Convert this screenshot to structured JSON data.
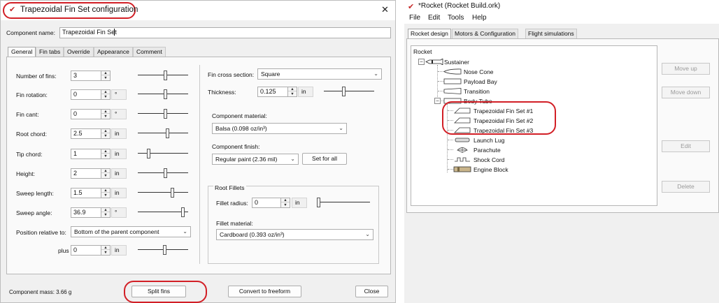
{
  "dialog": {
    "title": "Trapezoidal Fin Set configuration",
    "close_glyph": "✕",
    "component_name_label": "Component name:",
    "component_name_value": "Trapezoidal Fin Set",
    "tabs": [
      "General",
      "Fin tabs",
      "Override",
      "Appearance",
      "Comment"
    ],
    "fields": [
      {
        "label": "Number of fins:",
        "value": "3",
        "unit": ""
      },
      {
        "label": "Fin rotation:",
        "value": "0",
        "unit": "°"
      },
      {
        "label": "Fin cant:",
        "value": "0",
        "unit": "°"
      },
      {
        "label": "Root chord:",
        "value": "2.5",
        "unit": "in"
      },
      {
        "label": "Tip chord:",
        "value": "1",
        "unit": "in"
      },
      {
        "label": "Height:",
        "value": "2",
        "unit": "in"
      },
      {
        "label": "Sweep length:",
        "value": "1.5",
        "unit": "in"
      },
      {
        "label": "Sweep angle:",
        "value": "36.9",
        "unit": "°"
      }
    ],
    "position_relative_label": "Position relative to:",
    "position_relative_value": "Bottom of the parent component",
    "plus_label": "plus",
    "plus_value": "0",
    "plus_unit": "in",
    "cross_section_label": "Fin cross section:",
    "cross_section_value": "Square",
    "thickness_label": "Thickness:",
    "thickness_value": "0.125",
    "thickness_unit": "in",
    "material_label": "Component material:",
    "material_value": "Balsa (0.098 oz/in³)",
    "finish_label": "Component finish:",
    "finish_value": "Regular paint (2.36 mil)",
    "set_for_all": "Set for all",
    "root_fillets_title": "Root Fillets",
    "fillet_radius_label": "Fillet radius:",
    "fillet_radius_value": "0",
    "fillet_radius_unit": "in",
    "fillet_material_label": "Fillet material:",
    "fillet_material_value": "Cardboard (0.393 oz/in³)",
    "component_mass": "Component mass: 3.66 g",
    "split_fins": "Split fins",
    "convert_freeform": "Convert to freeform",
    "close": "Close"
  },
  "rocket_window": {
    "title": "*Rocket (Rocket Build.ork)",
    "menu": [
      "File",
      "Edit",
      "Tools",
      "Help"
    ],
    "tabs": [
      "Rocket design",
      "Motors & Configuration",
      "Flight simulations"
    ],
    "tree_root": "Rocket",
    "tree": [
      {
        "label": "Sustainer",
        "icon": "sustainer-icon"
      },
      {
        "label": "Nose Cone",
        "icon": "nose-cone-icon"
      },
      {
        "label": "Payload Bay",
        "icon": "body-tube-icon"
      },
      {
        "label": "Transition",
        "icon": "transition-icon"
      },
      {
        "label": "Body Tube",
        "icon": "body-tube-icon"
      },
      {
        "label": "Trapezoidal Fin Set #1",
        "icon": "fin-set-icon"
      },
      {
        "label": "Trapezoidal Fin Set #2",
        "icon": "fin-set-icon"
      },
      {
        "label": "Trapezoidal Fin Set #3",
        "icon": "fin-set-icon"
      },
      {
        "label": "Launch Lug",
        "icon": "launch-lug-icon"
      },
      {
        "label": "Parachute",
        "icon": "parachute-icon"
      },
      {
        "label": "Shock Cord",
        "icon": "shock-cord-icon"
      },
      {
        "label": "Engine Block",
        "icon": "engine-block-icon"
      }
    ],
    "side_buttons": [
      "Move up",
      "Move down",
      "Edit",
      "Delete"
    ]
  },
  "colors": {
    "highlight": "#d21f26",
    "window_bg": "#f0f0f0"
  }
}
